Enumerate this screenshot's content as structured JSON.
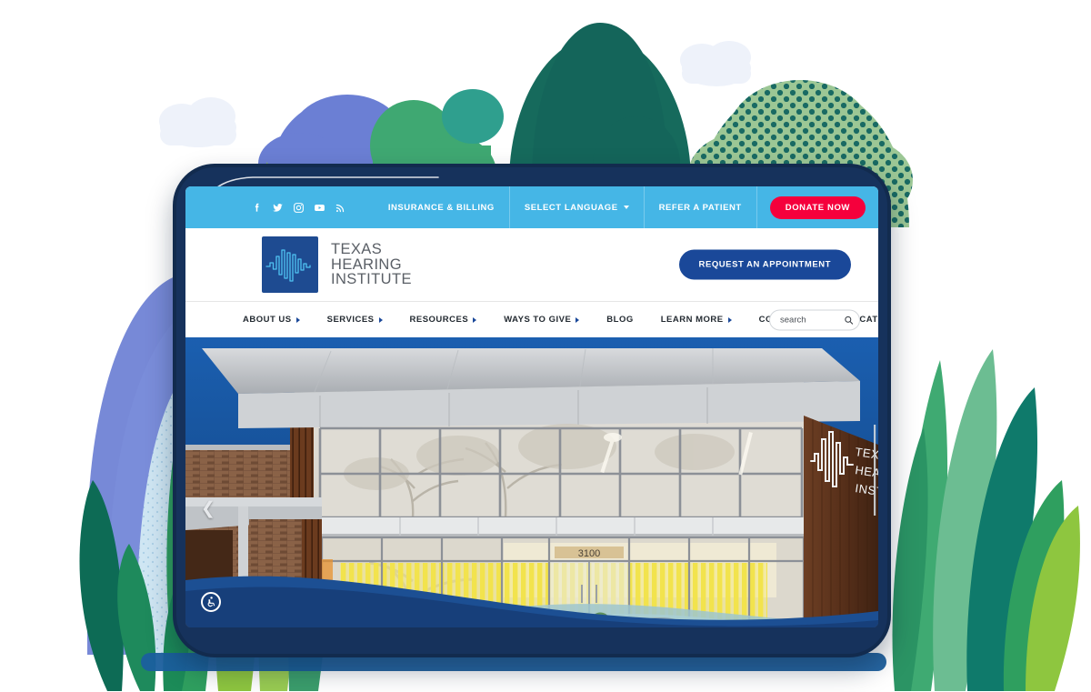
{
  "site": {
    "name": "Texas Hearing Institute",
    "logo_lines": [
      "TEXAS",
      "HEARING",
      "INSTITUTE"
    ],
    "logo_icon": "soundwave-logo-icon"
  },
  "colors": {
    "topbar": "#45b6e6",
    "donate": "#f5003c",
    "primary_blue": "#1a4899",
    "logo_navy": "#1e4b91",
    "device_frame": "#122b4e",
    "wave_navy": "#1c4f93"
  },
  "topbar": {
    "social": [
      {
        "name": "facebook-icon",
        "label": "Facebook"
      },
      {
        "name": "twitter-icon",
        "label": "Twitter"
      },
      {
        "name": "instagram-icon",
        "label": "Instagram"
      },
      {
        "name": "youtube-icon",
        "label": "YouTube"
      },
      {
        "name": "rss-icon",
        "label": "RSS"
      }
    ],
    "items": [
      {
        "label": "INSURANCE & BILLING",
        "has_caret": false
      },
      {
        "label": "SELECT LANGUAGE",
        "has_caret": true
      },
      {
        "label": "REFER A PATIENT",
        "has_caret": false
      }
    ],
    "donate_label": "DONATE NOW"
  },
  "header": {
    "appointment_label": "REQUEST AN APPOINTMENT"
  },
  "mainnav": {
    "items": [
      {
        "label": "ABOUT US",
        "has_caret": true
      },
      {
        "label": "SERVICES",
        "has_caret": true
      },
      {
        "label": "RESOURCES",
        "has_caret": true
      },
      {
        "label": "WAYS TO GIVE",
        "has_caret": true
      },
      {
        "label": "BLOG",
        "has_caret": false
      },
      {
        "label": "LEARN MORE",
        "has_caret": true
      },
      {
        "label": "CONTACT US",
        "has_caret": false
      },
      {
        "label": "LOCATIONS",
        "has_caret": true
      }
    ],
    "search": {
      "placeholder": "search",
      "value": "",
      "icon": "search-icon"
    }
  },
  "hero": {
    "alt": "Texas Hearing Institute building exterior at dusk",
    "building_sign_lines": [
      "TEXAS",
      "HEARING",
      "INSTITUTE"
    ],
    "address_number": "3100",
    "prev_arrow": "chevron-left-icon",
    "accessibility_icon": "wheelchair-accessibility-icon"
  }
}
